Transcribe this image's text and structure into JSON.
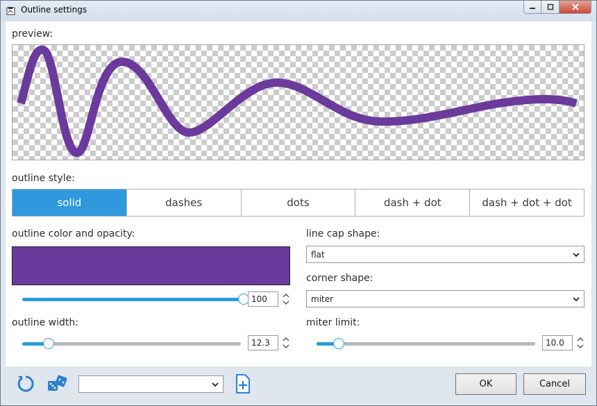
{
  "window": {
    "title": "Outline settings"
  },
  "preview": {
    "label": "preview:",
    "stroke_color": "#6b3a9c"
  },
  "outline_style": {
    "label": "outline style:",
    "options": [
      "solid",
      "dashes",
      "dots",
      "dash + dot",
      "dash + dot + dot"
    ],
    "selected": "solid"
  },
  "color": {
    "label": "outline color and opacity:",
    "value": "#6b3a9c",
    "opacity": "100",
    "opacity_fraction": 1.0
  },
  "width": {
    "label": "outline width:",
    "value": "12.3",
    "slider_fraction": 0.12
  },
  "line_cap": {
    "label": "line cap shape:",
    "value": "flat"
  },
  "corner": {
    "label": "corner shape:",
    "value": "miter"
  },
  "miter": {
    "label": "miter limit:",
    "value": "10.0",
    "slider_fraction": 0.1
  },
  "footer": {
    "preset_value": "",
    "ok_label": "OK",
    "cancel_label": "Cancel"
  },
  "accent_color": "#3098dc"
}
